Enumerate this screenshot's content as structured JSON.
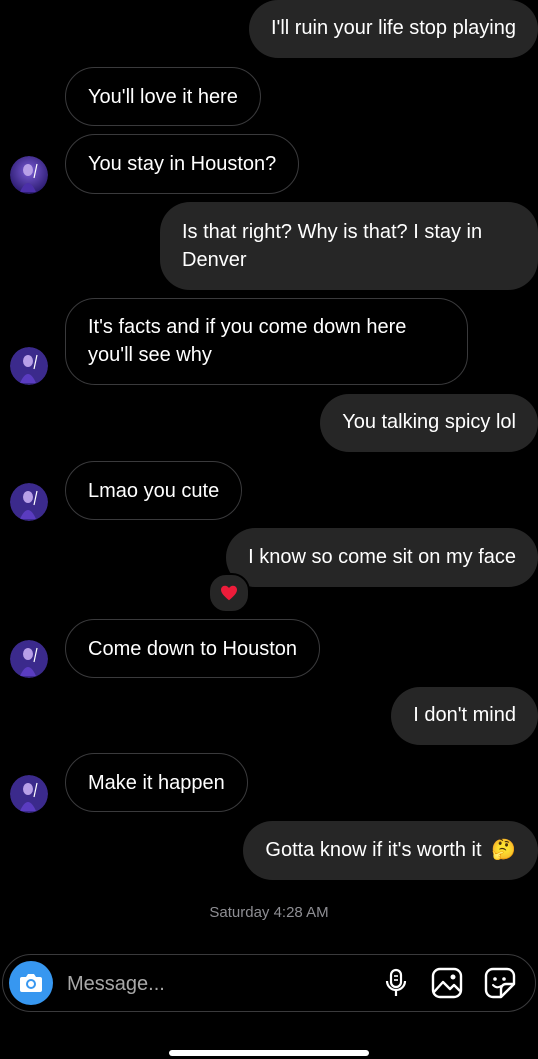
{
  "messages": [
    {
      "side": "out",
      "text": "I'll ruin your life stop playing"
    },
    {
      "side": "in",
      "text": "You'll love it here"
    },
    {
      "side": "in",
      "text": "You stay in Houston?"
    },
    {
      "side": "out",
      "text": "Is that right? Why is that? I stay in Denver"
    },
    {
      "side": "in",
      "text": "It's facts and if you come down here you'll see why"
    },
    {
      "side": "out",
      "text": "You talking spicy lol"
    },
    {
      "side": "in",
      "text": "Lmao you cute"
    },
    {
      "side": "out",
      "text": "I know so come sit on my face",
      "reaction": "❤️"
    },
    {
      "side": "in",
      "text": "Come down to Houston"
    },
    {
      "side": "out",
      "text": "I don't mind"
    },
    {
      "side": "in",
      "text": "Make it happen"
    },
    {
      "side": "out",
      "text": "Gotta know if it's worth it",
      "emoji": "🤔"
    }
  ],
  "timestamp": "Saturday 4:28 AM",
  "composer": {
    "placeholder": "Message...",
    "icons": [
      "camera-icon",
      "microphone-icon",
      "gallery-icon",
      "sticker-icon"
    ]
  },
  "colors": {
    "background": "#000000",
    "outgoing_bubble": "#262626",
    "incoming_border": "#3a3a3c",
    "accent": "#3797f0",
    "reaction_heart": "#ed1c3a"
  }
}
